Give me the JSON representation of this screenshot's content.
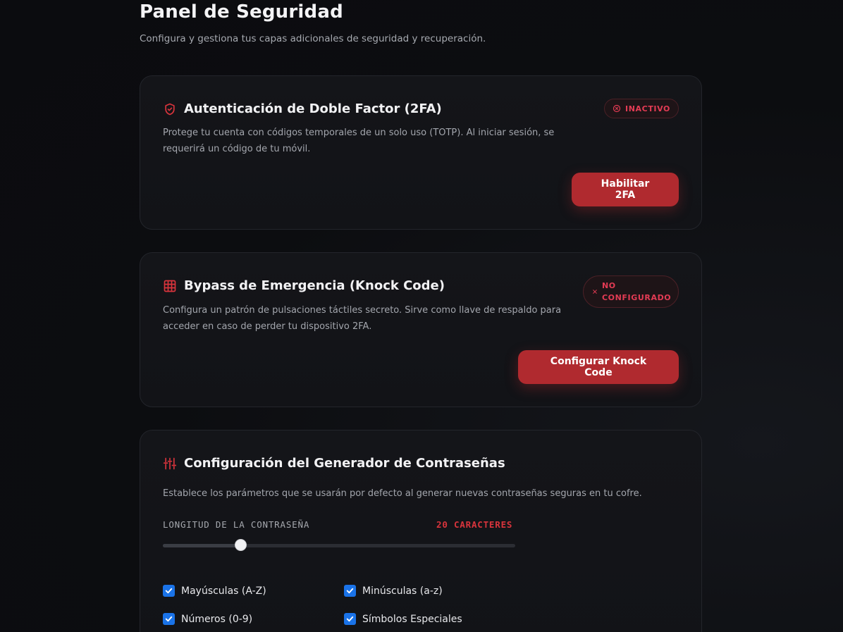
{
  "header": {
    "title": "Panel de Seguridad",
    "subtitle": "Configura y gestiona tus capas adicionales de seguridad y recuperación."
  },
  "twofa": {
    "icon": "shield-check-icon",
    "title": "Autenticación de Doble Factor (2FA)",
    "description": "Protege tu cuenta con códigos temporales de un solo uso (TOTP). Al iniciar sesión, se requerirá un código de tu móvil.",
    "status": "INACTIVO",
    "status_icon": "circle-x-icon",
    "button": "Habilitar 2FA"
  },
  "knock": {
    "icon": "grid-icon",
    "title": "Bypass de Emergencia (Knock Code)",
    "description": "Configura un patrón de pulsaciones táctiles secreto. Sirve como llave de respaldo para acceder en caso de perder tu dispositivo 2FA.",
    "status": "NO CONFIGURADO",
    "status_icon": "x-icon",
    "button": "Configurar Knock Code"
  },
  "generator": {
    "icon": "sliders-icon",
    "title": "Configuración del Generador de Contraseñas",
    "description": "Establece los parámetros que se usarán por defecto al generar nuevas contraseñas seguras en tu cofre.",
    "length_label": "LONGITUD DE LA CONTRASEÑA",
    "length_value": "20 CARACTERES",
    "length_fraction": 0.22,
    "options": [
      {
        "label": "Mayúsculas (A-Z)",
        "checked": true
      },
      {
        "label": "Minúsculas (a-z)",
        "checked": true
      },
      {
        "label": "Números (0-9)",
        "checked": true
      },
      {
        "label": "Símbolos Especiales",
        "checked": true
      }
    ]
  },
  "colors": {
    "accent": "#b02a2f",
    "danger_text": "#e33b54",
    "checkbox": "#1a73e8"
  }
}
